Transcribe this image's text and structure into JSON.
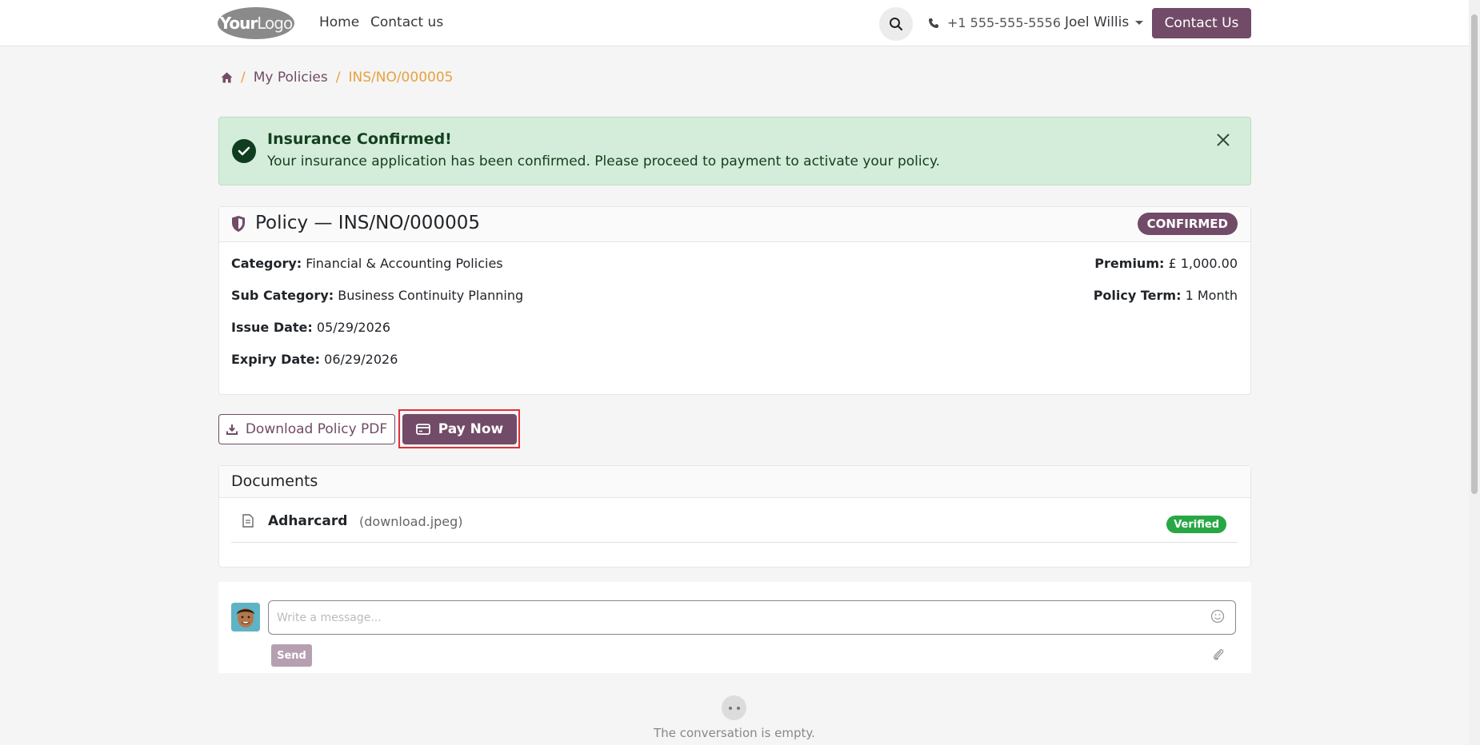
{
  "header": {
    "logo_text": "Your",
    "logo_text2": "Logo",
    "nav": [
      "Home",
      "Contact us"
    ],
    "phone": "+1 555-555-5556",
    "user": "Joel Willis",
    "contact_button": "Contact Us"
  },
  "breadcrumb": {
    "link": "My Policies",
    "current": "INS/NO/000005"
  },
  "alert": {
    "title": "Insurance Confirmed!",
    "message": "Your insurance application has been confirmed. Please proceed to payment to activate your policy."
  },
  "policy": {
    "title": "Policy — INS/NO/000005",
    "status": "CONFIRMED",
    "category_label": "Category:",
    "category": "Financial & Accounting Policies",
    "subcategory_label": "Sub Category:",
    "subcategory": "Business Continuity Planning",
    "issue_label": "Issue Date:",
    "issue_date": "05/29/2026",
    "expiry_label": "Expiry Date:",
    "expiry_date": "06/29/2026",
    "premium_label": "Premium:",
    "premium": "£ 1,000.00",
    "term_label": "Policy Term:",
    "term": "1 Month"
  },
  "actions": {
    "download": "Download Policy PDF",
    "pay": "Pay Now"
  },
  "documents": {
    "title": "Documents",
    "items": [
      {
        "name": "Adharcard",
        "file": "(download.jpeg)",
        "status": "Verified"
      }
    ]
  },
  "chatter": {
    "placeholder": "Write a message...",
    "send": "Send",
    "empty": "The conversation is empty."
  },
  "colors": {
    "brand": "#714b67",
    "accent": "#e6a23c",
    "success": "#28a745"
  }
}
